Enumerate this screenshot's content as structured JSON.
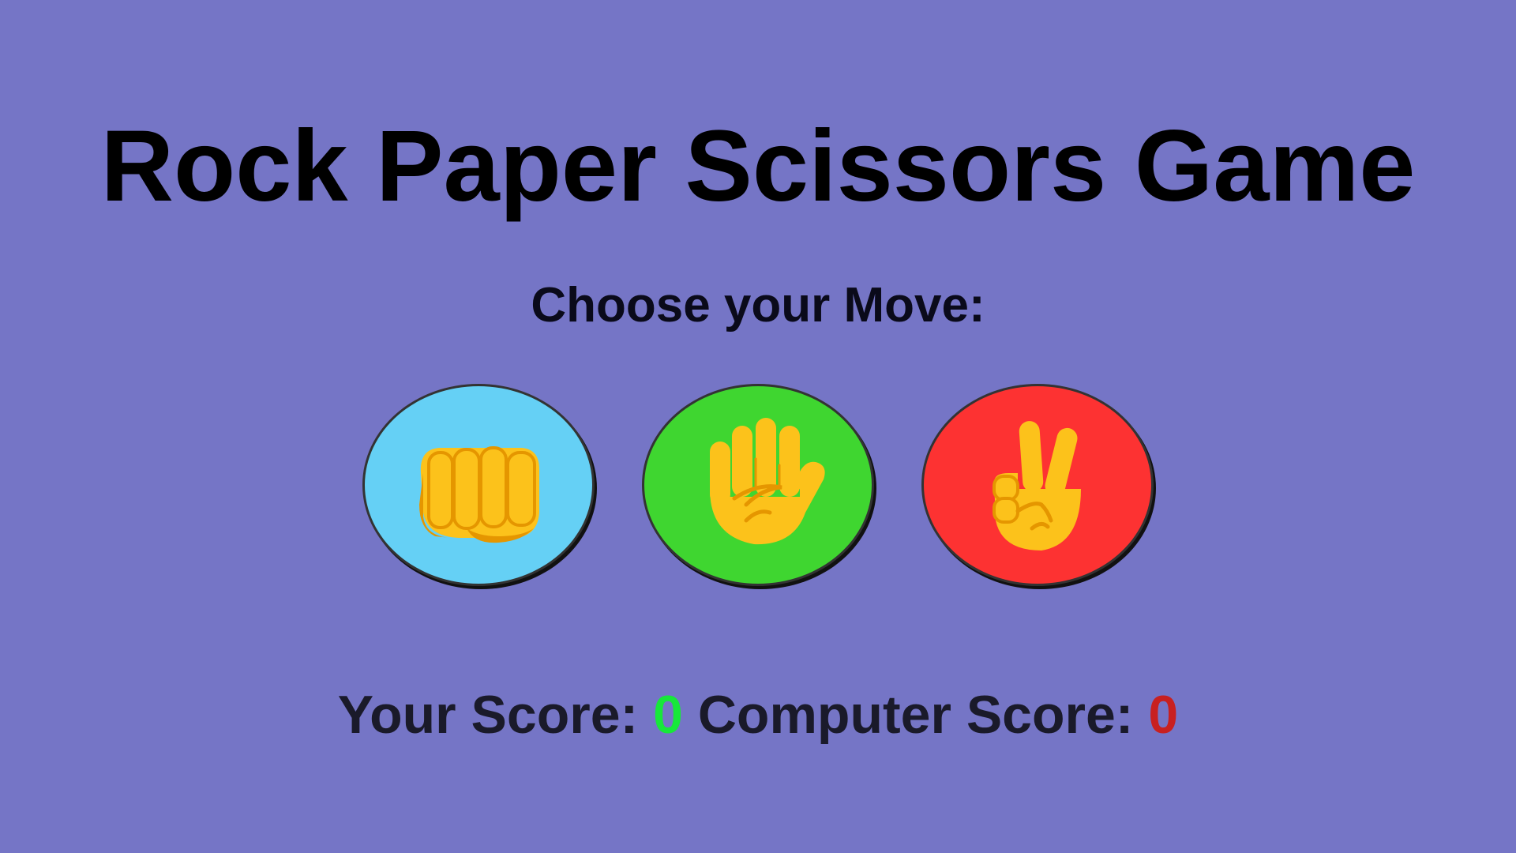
{
  "title": "Rock Paper Scissors Game",
  "prompt": "Choose your Move:",
  "moves": [
    {
      "name": "rock",
      "icon": "fist-icon",
      "color": "#65d0f5"
    },
    {
      "name": "paper",
      "icon": "open-hand-icon",
      "color": "#3fd630"
    },
    {
      "name": "scissors",
      "icon": "victory-hand-icon",
      "color": "#fd3232"
    }
  ],
  "scoreboard": {
    "user_label": "Your Score:",
    "user_score": "0",
    "user_color": "#17e83a",
    "computer_label": "Computer Score:",
    "computer_score": "0",
    "computer_color": "#c82020"
  },
  "colors": {
    "background": "#7575c6"
  }
}
